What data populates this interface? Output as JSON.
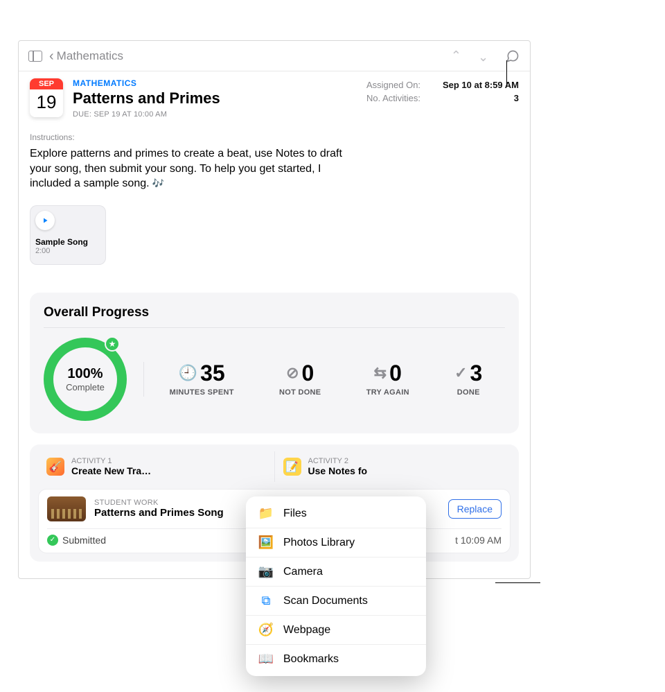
{
  "nav": {
    "back_label": "Mathematics"
  },
  "calendar": {
    "month": "SEP",
    "day": "19"
  },
  "assignment": {
    "category": "MATHEMATICS",
    "title": "Patterns and Primes",
    "due": "DUE: SEP 19 AT 10:00 AM"
  },
  "meta": {
    "assigned_on_label": "Assigned On:",
    "assigned_on_value": "Sep 10 at 8:59 AM",
    "activities_label": "No. Activities:",
    "activities_value": "3"
  },
  "instructions": {
    "label": "Instructions:",
    "text": "Explore patterns and primes to create a beat, use Notes to draft your song, then submit your song. To help you get started, I included a sample song."
  },
  "attachment": {
    "name": "Sample Song",
    "duration": "2:00"
  },
  "progress": {
    "title": "Overall Progress",
    "ring_pct": "100%",
    "ring_label": "Complete",
    "stats": {
      "minutes_value": "35",
      "minutes_label": "MINUTES SPENT",
      "notdone_value": "0",
      "notdone_label": "NOT DONE",
      "tryagain_value": "0",
      "tryagain_label": "TRY AGAIN",
      "done_value": "3",
      "done_label": "DONE"
    }
  },
  "activities": {
    "a1_label": "ACTIVITY 1",
    "a1_title": "Create New Tra…",
    "a2_label": "ACTIVITY 2",
    "a2_title": "Use Notes fo"
  },
  "work": {
    "label": "STUDENT WORK",
    "title": "Patterns and Primes Song",
    "replace": "Replace",
    "status": "Submitted",
    "timestamp": "t 10:09 AM"
  },
  "popover": {
    "files": "Files",
    "photos": "Photos Library",
    "camera": "Camera",
    "scan": "Scan Documents",
    "webpage": "Webpage",
    "bookmarks": "Bookmarks"
  }
}
